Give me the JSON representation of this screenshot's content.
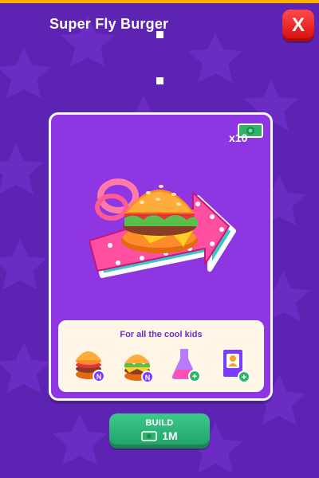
{
  "ui": {
    "close_label": "X",
    "card": {
      "title": "Super Fly Burger",
      "cash_multiplier": "x10",
      "panel_title": "For all the cool kids",
      "perks": [
        {
          "icon": "double-stack-burger-icon",
          "badge": "N"
        },
        {
          "icon": "cheeseburger-icon",
          "badge": "N"
        },
        {
          "icon": "lab-flask-icon",
          "badge": "+"
        },
        {
          "icon": "employee-card-icon",
          "badge": "+"
        }
      ]
    },
    "build": {
      "label": "BUILD",
      "cost": "1M"
    }
  }
}
